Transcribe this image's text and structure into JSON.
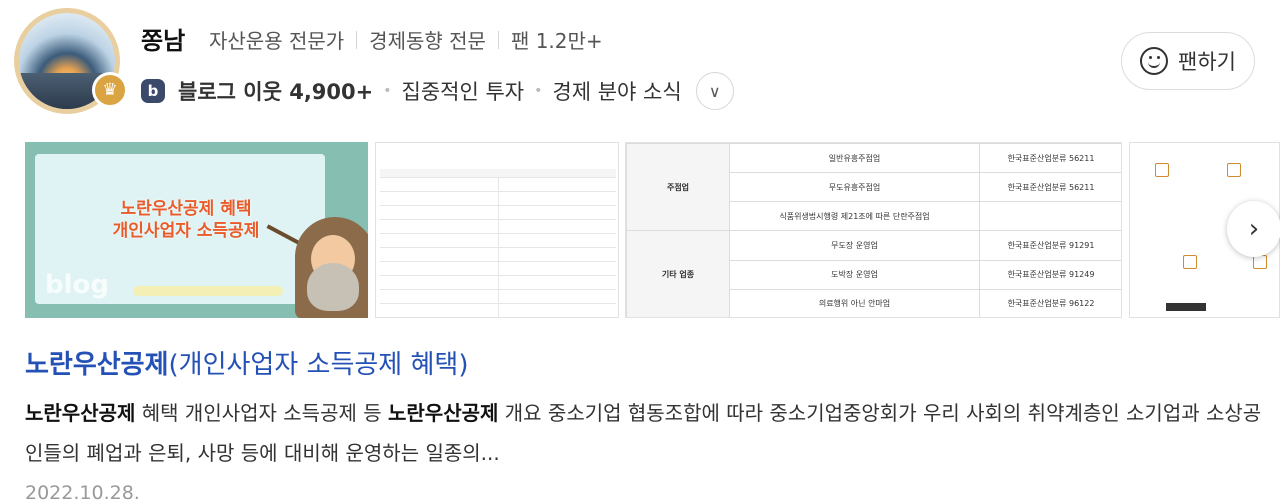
{
  "profile": {
    "name": "쫑남",
    "tags": [
      "자산운용 전문가",
      "경제동향 전문",
      "팬 1.2만+"
    ],
    "badge_letter": "b",
    "blog_neighbors": "블로그 이웃 4,900+",
    "topics": [
      "집중적인 투자",
      "경제 분야 소식"
    ],
    "fan_button": "팬하기",
    "crown_icon": "♛",
    "expand_icon": "∨"
  },
  "thumbnails": {
    "t1": {
      "title_line1": "노란우산공제 혜택",
      "title_line2": "개인사업자 소득공제",
      "watermark": "blog"
    },
    "t3": {
      "rows": [
        {
          "category": "주점업",
          "item": "일반유흥주점업",
          "code": "한국표준산업분류 56211"
        },
        {
          "category": "",
          "item": "무도유흥주점업",
          "code": "한국표준산업분류 56211"
        },
        {
          "category": "",
          "item": "식품위생법시행령 제21조에 따른 단란주점업",
          "code": ""
        },
        {
          "category": "기타 업종",
          "item": "무도장 운영업",
          "code": "한국표준산업분류 91291"
        },
        {
          "category": "",
          "item": "도박장 운영업",
          "code": "한국표준산업분류 91249"
        },
        {
          "category": "",
          "item": "의료행위 아닌 안마업",
          "code": "한국표준산업분류 96122"
        }
      ]
    },
    "next_icon": "›"
  },
  "post": {
    "title_highlight": "노란우산공제",
    "title_rest": "(개인사업자 소득공제 혜택)",
    "snippet_k1": "노란우산공제",
    "snippet_p1": " 혜택 개인사업자 소득공제 등 ",
    "snippet_k2": "노란우산공제",
    "snippet_p2": " 개요 중소기업 협동조합에 따라 중소기업중앙회가 우리 사회의 취약계층인 소기업과 소상공인들의 폐업과 은퇴, 사망 등에 대비해 운영하는 일종의...",
    "date": "2022.10.28."
  }
}
